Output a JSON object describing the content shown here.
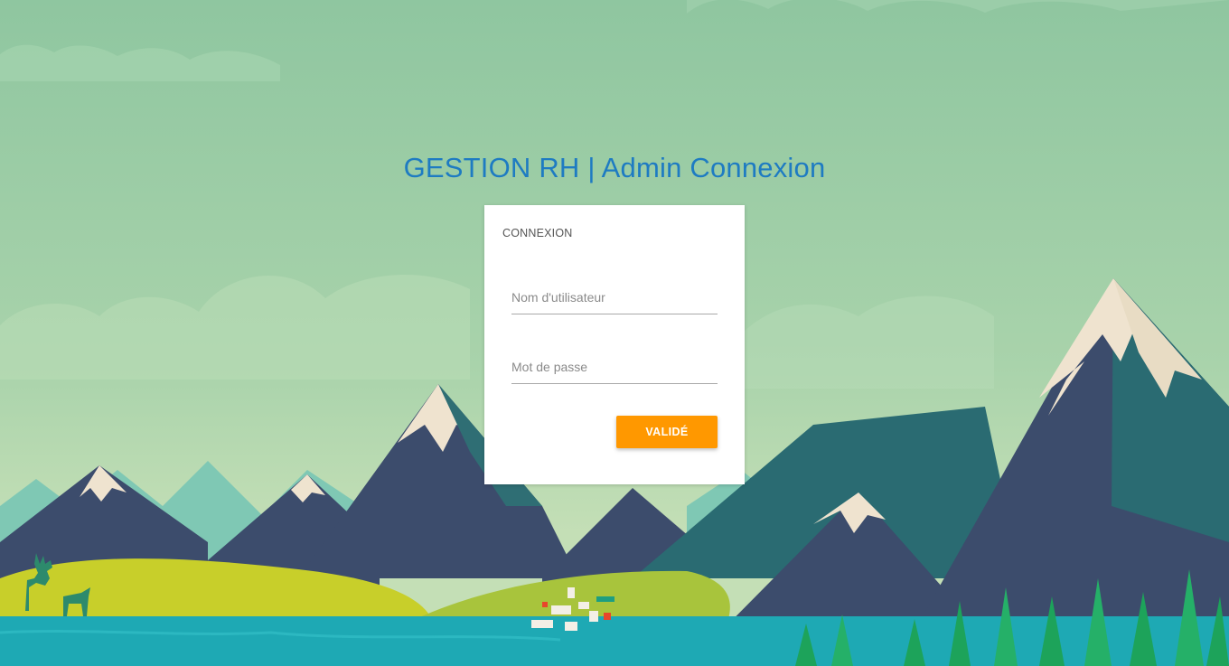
{
  "header": {
    "title": "GESTION RH | Admin Connexion"
  },
  "login_card": {
    "title": "CONNEXION",
    "username": {
      "value": "",
      "placeholder": "Nom d'utilisateur"
    },
    "password": {
      "value": "",
      "placeholder": "Mot de passe"
    },
    "submit_label": "VALIDÉ"
  },
  "colors": {
    "title": "#1e7bc2",
    "button": "#ff9800",
    "card": "#ffffff",
    "sky": "#93c9a4"
  },
  "background": {
    "illustration": "mountain-landscape-illustration"
  }
}
